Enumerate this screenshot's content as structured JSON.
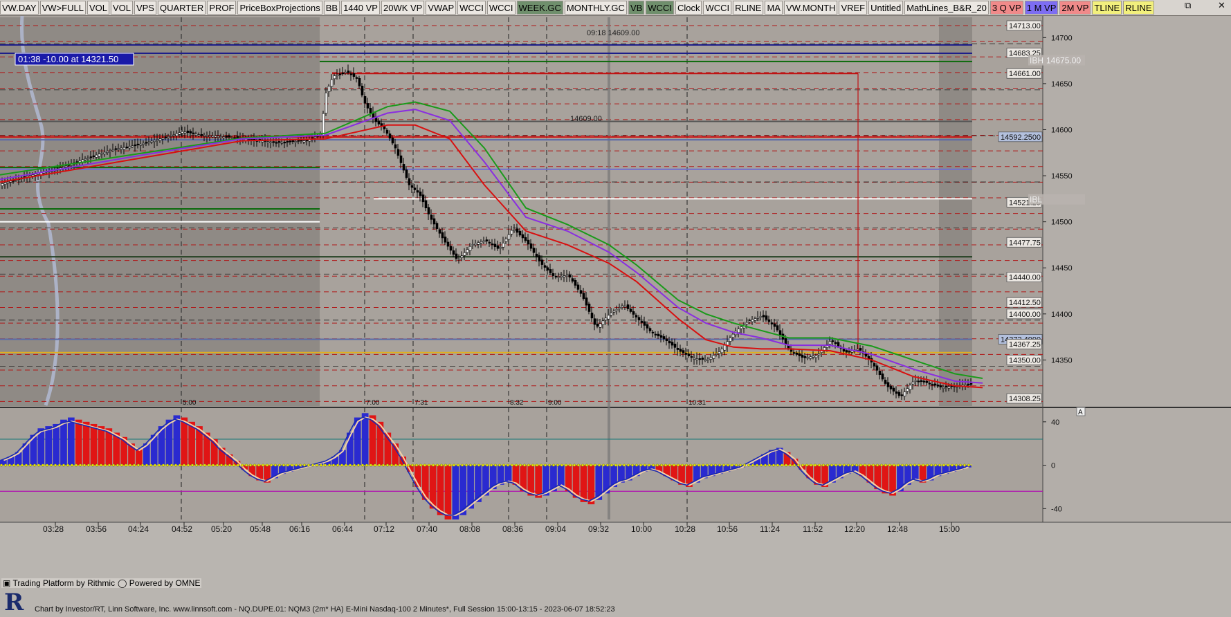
{
  "toolbar": {
    "items": [
      {
        "label": "VW.DAY",
        "bg": "#ebe7e2"
      },
      {
        "label": "VW>FULL",
        "bg": "#ebe7e2"
      },
      {
        "label": "VOL",
        "bg": "#ebe7e2"
      },
      {
        "label": "VOL",
        "bg": "#ebe7e2"
      },
      {
        "label": "VPS",
        "bg": "#ebe7e2"
      },
      {
        "label": "QUARTER",
        "bg": "#ebe7e2"
      },
      {
        "label": "PROF",
        "bg": "#ebe7e2"
      },
      {
        "label": "PriceBoxProjections",
        "bg": "#ebe7e2"
      },
      {
        "label": "BB",
        "bg": "#ebe7e2"
      },
      {
        "label": "1440 VP",
        "bg": "#ebe7e2"
      },
      {
        "label": "20WK VP",
        "bg": "#ebe7e2"
      },
      {
        "label": "VWAP",
        "bg": "#ebe7e2"
      },
      {
        "label": "WCCI",
        "bg": "#ebe7e2"
      },
      {
        "label": "WCCI",
        "bg": "#ebe7e2"
      },
      {
        "label": "WEEK.GC",
        "bg": "#6f8f6c"
      },
      {
        "label": "MONTHLY.GC",
        "bg": "#ebe7e2"
      },
      {
        "label": "VB",
        "bg": "#6f8f6c"
      },
      {
        "label": "WCCI",
        "bg": "#6f8f6c"
      },
      {
        "label": "Clock",
        "bg": "#ebe7e2"
      },
      {
        "label": "WCCI",
        "bg": "#ebe7e2"
      },
      {
        "label": "RLINE",
        "bg": "#ebe7e2"
      },
      {
        "label": "MA",
        "bg": "#ebe7e2"
      },
      {
        "label": "VW.MONTH",
        "bg": "#ebe7e2"
      },
      {
        "label": "VREF",
        "bg": "#ebe7e2"
      },
      {
        "label": "Untitled",
        "bg": "#ebe7e2"
      },
      {
        "label": "MathLines_B&R_20",
        "bg": "#ebe7e2"
      },
      {
        "label": "3 Q VP",
        "bg": "#f08a8a"
      },
      {
        "label": "1 M VP",
        "bg": "#7d6df2"
      },
      {
        "label": "2M VP",
        "bg": "#f08a8a"
      },
      {
        "label": "TLINE",
        "bg": "#f2f07d"
      },
      {
        "label": "RLINE",
        "bg": "#f2f07d"
      }
    ],
    "window_controls": [
      "⧉",
      "✕"
    ]
  },
  "footer": {
    "rithmic": "Trading Platform by Rithmic",
    "omne": "Powered by OMNE",
    "info": "Chart by Investor/RT, Linn Software, Inc. www.linnsoft.com - NQ.DUPE.01: NQM3 (2m* HA) E-Mini Nasdaq-100 2 Minutes*, Full Session 15:00-13:15 - 2023-06-07 18:52:23"
  },
  "chart_data": [
    {
      "type": "candlestick",
      "instrument": "NQM3 E-Mini Nasdaq-100 2 Minutes",
      "ylim": [
        14300,
        14722
      ],
      "y_ticks": [
        14350,
        14400,
        14450,
        14500,
        14550,
        14600,
        14650,
        14700
      ],
      "x_ticks": [
        "03:28",
        "03:56",
        "04:24",
        "04:52",
        "05:20",
        "05:48",
        "06:16",
        "06:44",
        "07:12",
        "07:40",
        "08:08",
        "08:36",
        "09:04",
        "09:32",
        "10:00",
        "10:28",
        "10:56",
        "11:24",
        "11:52",
        "12:20",
        "12:48",
        "15:00"
      ],
      "session_markers": [
        "5:00",
        "7:00",
        "7:31",
        "8:32",
        "9:00",
        "10:31"
      ],
      "info_box": "01:38  -10.00 at 14321.50",
      "top_annotation": "09:18  14609.00",
      "mid_annotation": "14609.00",
      "price_labels": [
        {
          "value": "14713.00",
          "price": 14713,
          "color": "#ebe7e2"
        },
        {
          "value": "14683.25",
          "price": 14683.25,
          "color": "#ebe7e2"
        },
        {
          "value": "14661.00",
          "price": 14661,
          "color": "#ebe7e2"
        },
        {
          "value": "14592.2500",
          "price": 14592.25,
          "color": "#b3c0dd"
        },
        {
          "value": "14521.25",
          "price": 14521.25,
          "color": "#ebe7e2"
        },
        {
          "value": "14477.75",
          "price": 14477.75,
          "color": "#ebe7e2"
        },
        {
          "value": "14440.00",
          "price": 14440,
          "color": "#ebe7e2"
        },
        {
          "value": "14412.50",
          "price": 14412.5,
          "color": "#ebe7e2"
        },
        {
          "value": "14400.00",
          "price": 14400,
          "color": "#ebe7e2"
        },
        {
          "value": "14372.4990",
          "price": 14372.499,
          "color": "#b3c0dd"
        },
        {
          "value": "14367.25",
          "price": 14367.25,
          "color": "#ebe7e2"
        },
        {
          "value": "14350.00",
          "price": 14350,
          "color": "#ebe7e2"
        },
        {
          "value": "14308.25",
          "price": 14308.25,
          "color": "#ebe7e2"
        }
      ],
      "right_tags": [
        {
          "text": "IBH",
          "value": "14675.00",
          "price": 14675
        },
        {
          "text": "IBL",
          "value": "",
          "price": 14524
        }
      ],
      "horizontal_lines": [
        {
          "price": 14692,
          "color": "#1e1e8a",
          "style": "solid"
        },
        {
          "price": 14683,
          "color": "#1e1e8a",
          "style": "solid"
        },
        {
          "price": 14674,
          "color": "#0a6a0a",
          "style": "solid",
          "start": "06:16"
        },
        {
          "price": 14661,
          "color": "#c01010",
          "style": "solid",
          "start": "06:44",
          "end": "12:20"
        },
        {
          "price": 14609,
          "color": "#555555",
          "style": "solid"
        },
        {
          "price": 14592,
          "color": "#d01010",
          "style": "solid"
        },
        {
          "price": 14589,
          "color": "#5a6aa8",
          "style": "solid"
        },
        {
          "price": 14559,
          "color": "#0a6a0a",
          "style": "solid",
          "end": "06:16"
        },
        {
          "price": 14557,
          "color": "#6f6fd0",
          "style": "solid"
        },
        {
          "price": 14525,
          "color": "#ffffff",
          "style": "solid",
          "start": "07:12"
        },
        {
          "price": 14514,
          "color": "#0a6a0a",
          "style": "solid",
          "end": "06:16"
        },
        {
          "price": 14500,
          "color": "#ffffff",
          "style": "solid",
          "end": "06:16"
        },
        {
          "price": 14462,
          "color": "#1a3a1a",
          "style": "solid"
        },
        {
          "price": 14372.5,
          "color": "#5a6aa8",
          "style": "solid"
        },
        {
          "price": 14358,
          "color": "#e0b020",
          "style": "solid"
        }
      ],
      "ma_lines": [
        {
          "name": "MA1",
          "color": "#1a9a1a",
          "points": [
            [
              0,
              14551
            ],
            [
              210,
              14575
            ],
            [
              350,
              14591
            ],
            [
              470,
              14596
            ],
            [
              560,
              14625
            ],
            [
              600,
              14630
            ],
            [
              650,
              14620
            ],
            [
              700,
              14580
            ],
            [
              760,
              14515
            ],
            [
              820,
              14497
            ],
            [
              880,
              14475
            ],
            [
              920,
              14453
            ],
            [
              980,
              14415
            ],
            [
              1020,
              14400
            ],
            [
              1060,
              14390
            ],
            [
              1100,
              14382
            ],
            [
              1140,
              14374
            ],
            [
              1200,
              14374
            ],
            [
              1260,
              14365
            ],
            [
              1320,
              14350
            ],
            [
              1380,
              14335
            ],
            [
              1420,
              14330
            ]
          ]
        },
        {
          "name": "MA2",
          "color": "#8a2ee0",
          "points": [
            [
              0,
              14546
            ],
            [
              210,
              14573
            ],
            [
              350,
              14590
            ],
            [
              470,
              14594
            ],
            [
              560,
              14618
            ],
            [
              600,
              14622
            ],
            [
              650,
              14610
            ],
            [
              700,
              14565
            ],
            [
              760,
              14505
            ],
            [
              820,
              14490
            ],
            [
              880,
              14467
            ],
            [
              920,
              14445
            ],
            [
              980,
              14407
            ],
            [
              1020,
              14390
            ],
            [
              1060,
              14380
            ],
            [
              1100,
              14374
            ],
            [
              1140,
              14366
            ],
            [
              1200,
              14366
            ],
            [
              1260,
              14356
            ],
            [
              1320,
              14340
            ],
            [
              1380,
              14327
            ],
            [
              1420,
              14325
            ]
          ]
        },
        {
          "name": "MA3",
          "color": "#d81010",
          "points": [
            [
              0,
              14543
            ],
            [
              210,
              14570
            ],
            [
              350,
              14588
            ],
            [
              470,
              14590
            ],
            [
              560,
              14605
            ],
            [
              600,
              14605
            ],
            [
              650,
              14590
            ],
            [
              700,
              14540
            ],
            [
              760,
              14490
            ],
            [
              820,
              14475
            ],
            [
              880,
              14455
            ],
            [
              920,
              14435
            ],
            [
              980,
              14395
            ],
            [
              1020,
              14372
            ],
            [
              1060,
              14364
            ],
            [
              1100,
              14362
            ],
            [
              1140,
              14362
            ],
            [
              1200,
              14360
            ],
            [
              1260,
              14350
            ],
            [
              1320,
              14332
            ],
            [
              1380,
              14322
            ],
            [
              1420,
              14320
            ]
          ]
        }
      ],
      "price_path": [
        [
          0,
          14541
        ],
        [
          40,
          14550
        ],
        [
          80,
          14557
        ],
        [
          120,
          14568
        ],
        [
          160,
          14578
        ],
        [
          200,
          14584
        ],
        [
          240,
          14592
        ],
        [
          262,
          14598
        ],
        [
          290,
          14594
        ],
        [
          330,
          14592
        ],
        [
          360,
          14589
        ],
        [
          400,
          14586
        ],
        [
          440,
          14588
        ],
        [
          462,
          14595
        ],
        [
          470,
          14640
        ],
        [
          480,
          14658
        ],
        [
          500,
          14663
        ],
        [
          515,
          14655
        ],
        [
          525,
          14630
        ],
        [
          540,
          14610
        ],
        [
          555,
          14600
        ],
        [
          570,
          14580
        ],
        [
          590,
          14540
        ],
        [
          605,
          14530
        ],
        [
          620,
          14505
        ],
        [
          640,
          14480
        ],
        [
          660,
          14458
        ],
        [
          680,
          14475
        ],
        [
          700,
          14480
        ],
        [
          720,
          14470
        ],
        [
          740,
          14493
        ],
        [
          760,
          14478
        ],
        [
          780,
          14455
        ],
        [
          800,
          14440
        ],
        [
          820,
          14442
        ],
        [
          840,
          14420
        ],
        [
          860,
          14385
        ],
        [
          880,
          14400
        ],
        [
          900,
          14410
        ],
        [
          920,
          14395
        ],
        [
          940,
          14380
        ],
        [
          960,
          14372
        ],
        [
          980,
          14360
        ],
        [
          1000,
          14352
        ],
        [
          1020,
          14350
        ],
        [
          1040,
          14360
        ],
        [
          1060,
          14380
        ],
        [
          1080,
          14392
        ],
        [
          1100,
          14398
        ],
        [
          1120,
          14385
        ],
        [
          1140,
          14360
        ],
        [
          1160,
          14352
        ],
        [
          1180,
          14355
        ],
        [
          1200,
          14372
        ],
        [
          1220,
          14358
        ],
        [
          1240,
          14362
        ],
        [
          1260,
          14346
        ],
        [
          1280,
          14322
        ],
        [
          1300,
          14310
        ],
        [
          1320,
          14328
        ],
        [
          1340,
          14325
        ],
        [
          1360,
          14320
        ],
        [
          1380,
          14322
        ],
        [
          1405,
          14324
        ]
      ],
      "ylabel": ""
    },
    {
      "type": "histogram",
      "name": "oscillator",
      "ylim": [
        -50,
        52
      ],
      "y_ticks": [
        40,
        0,
        -40
      ],
      "levels": [
        {
          "value": 24,
          "color": "#1a7a7a"
        },
        {
          "value": -24,
          "color": "#b010b0"
        }
      ],
      "values": [
        5,
        8,
        12,
        20,
        28,
        34,
        36,
        38,
        42,
        44,
        42,
        40,
        38,
        36,
        34,
        30,
        26,
        20,
        15,
        20,
        28,
        36,
        42,
        46,
        44,
        40,
        36,
        30,
        24,
        16,
        10,
        4,
        -4,
        -10,
        -14,
        -16,
        -12,
        -8,
        -6,
        -4,
        -2,
        0,
        2,
        4,
        8,
        14,
        30,
        44,
        48,
        46,
        40,
        30,
        20,
        8,
        -6,
        -20,
        -32,
        -40,
        -46,
        -50,
        -50,
        -46,
        -40,
        -34,
        -28,
        -22,
        -18,
        -16,
        -18,
        -24,
        -28,
        -30,
        -28,
        -24,
        -20,
        -24,
        -30,
        -34,
        -36,
        -32,
        -26,
        -20,
        -16,
        -14,
        -10,
        -6,
        -4,
        -6,
        -10,
        -14,
        -18,
        -20,
        -16,
        -12,
        -10,
        -8,
        -6,
        -4,
        -2,
        2,
        6,
        10,
        14,
        16,
        12,
        6,
        -4,
        -12,
        -18,
        -20,
        -16,
        -12,
        -8,
        -6,
        -10,
        -16,
        -22,
        -26,
        -28,
        -24,
        -18,
        -14,
        -16,
        -14,
        -10,
        -8,
        -6,
        -4,
        -2
      ],
      "signal_color": "#1a2ab0",
      "slow_color": "#f3d3a8"
    }
  ]
}
